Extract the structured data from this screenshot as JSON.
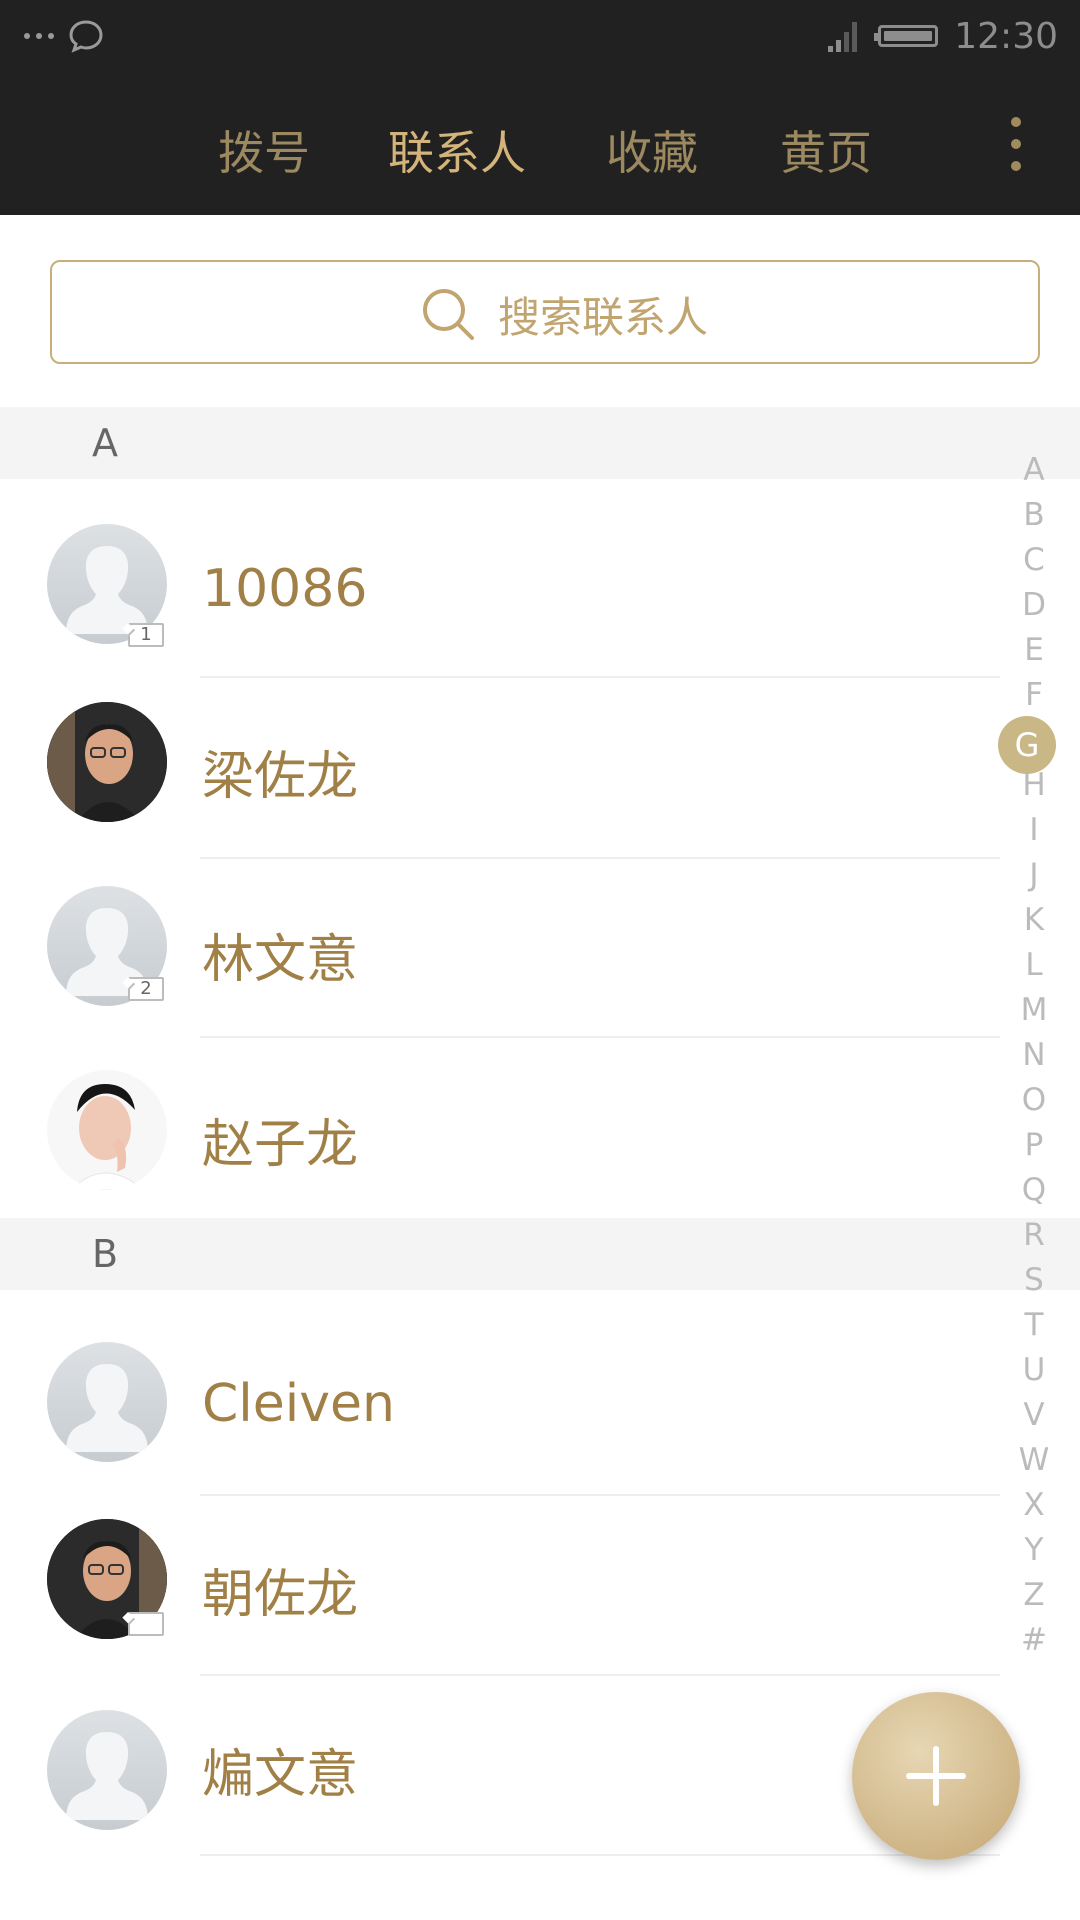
{
  "status_bar": {
    "time": "12:30"
  },
  "tabs": [
    {
      "label": "拨号",
      "active": false
    },
    {
      "label": "联系人",
      "active": true
    },
    {
      "label": "收藏",
      "active": false
    },
    {
      "label": "黄页",
      "active": false
    }
  ],
  "search": {
    "placeholder": "搜索联系人"
  },
  "sections": [
    {
      "letter": "A",
      "contacts": [
        {
          "name": "10086",
          "avatar": "default-avatar",
          "sim": "1"
        },
        {
          "name": "梁佐龙",
          "avatar": "photo-avatar",
          "sim": ""
        },
        {
          "name": "林文意",
          "avatar": "default-avatar",
          "sim": "2"
        },
        {
          "name": "赵子龙",
          "avatar": "photo-avatar",
          "sim": ""
        }
      ]
    },
    {
      "letter": "B",
      "contacts": [
        {
          "name": "Cleiven",
          "avatar": "default-avatar",
          "sim": ""
        },
        {
          "name": "朝佐龙",
          "avatar": "photo-avatar",
          "sim": ""
        },
        {
          "name": "煸文意",
          "avatar": "default-avatar",
          "sim": ""
        }
      ]
    }
  ],
  "index": {
    "letters": [
      "A",
      "B",
      "C",
      "D",
      "E",
      "F",
      "G",
      "H",
      "I",
      "J",
      "K",
      "L",
      "M",
      "N",
      "O",
      "P",
      "Q",
      "R",
      "S",
      "T",
      "U",
      "V",
      "W",
      "X",
      "Y",
      "Z",
      "#"
    ],
    "selected": "G"
  },
  "colors": {
    "accent": "#a08046",
    "header_bg": "#212121",
    "active_tab": "#d4b47b",
    "index_highlight": "#c9b886"
  }
}
